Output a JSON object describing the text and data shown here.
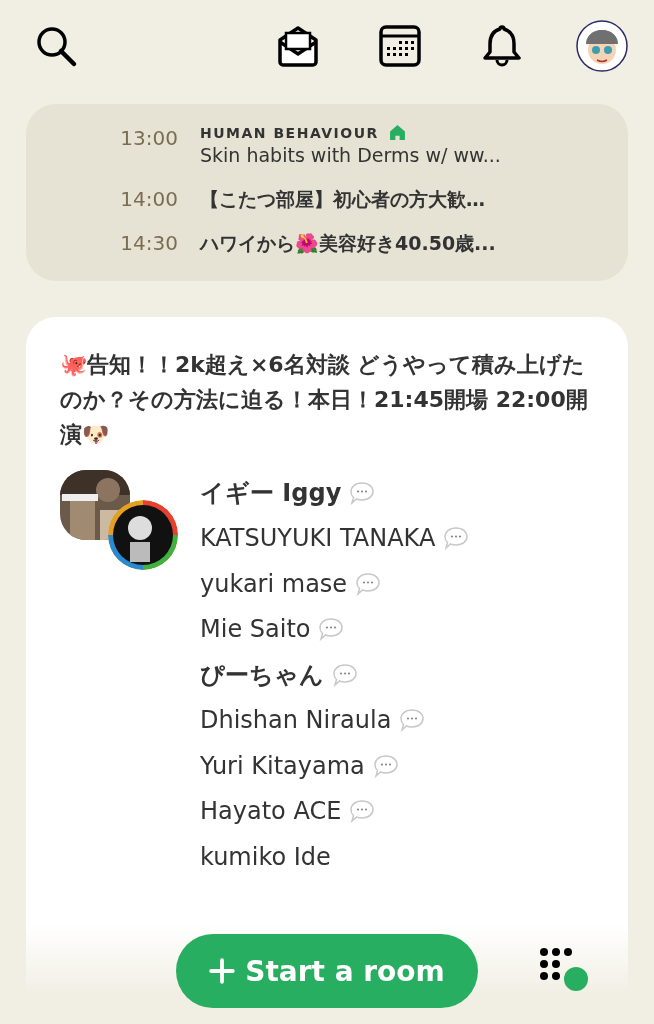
{
  "schedule": [
    {
      "time": "13:00",
      "club": "HUMAN BEHAVIOUR",
      "club_home": true,
      "title": "Skin habits with Derms w/ ww..."
    },
    {
      "time": "14:00",
      "title": "【こたつ部屋】初心者の方大歓…"
    },
    {
      "time": "14:30",
      "title": "ハワイから🌺美容好き40.50歳..."
    }
  ],
  "room": {
    "title": "🐙告知！！2k超え×6名対談 どうやって積み上げたのか？その方法に迫る！本日！21:45開場 22:00開演🐶",
    "speakers": [
      {
        "name": "イギー Iggy",
        "bold": true,
        "chat": true
      },
      {
        "name": "KATSUYUKI TANAKA",
        "bold": false,
        "chat": true
      },
      {
        "name": "yukari mase",
        "bold": false,
        "chat": true
      },
      {
        "name": "Mie Saito",
        "bold": false,
        "chat": true
      },
      {
        "name": "ぴーちゃん",
        "bold": true,
        "chat": true
      },
      {
        "name": "Dhishan Niraula",
        "bold": false,
        "chat": true
      },
      {
        "name": "Yuri Kitayama",
        "bold": false,
        "chat": true
      },
      {
        "name": "Hayato ACE",
        "bold": false,
        "chat": true
      },
      {
        "name": "kumiko Ide",
        "bold": false,
        "chat": false
      }
    ]
  },
  "start_button": {
    "label": "Start a room"
  },
  "online_indicator": true
}
